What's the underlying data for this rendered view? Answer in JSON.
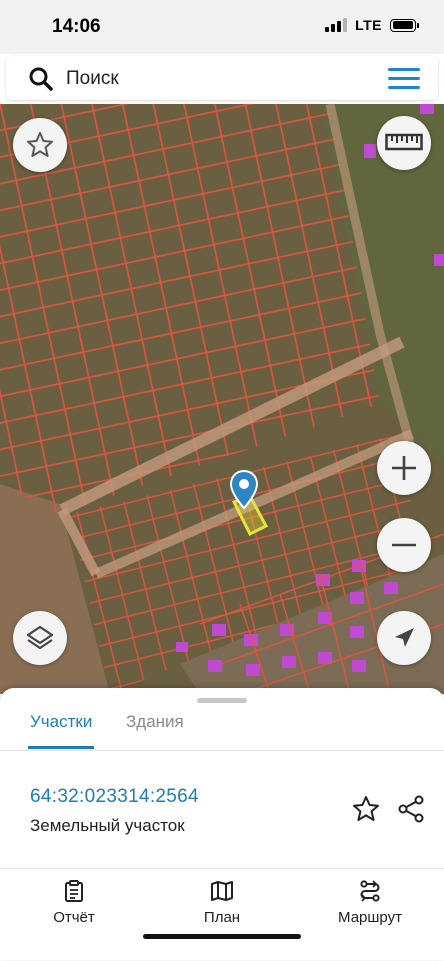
{
  "status_bar": {
    "time": "14:06",
    "network": "LTE"
  },
  "search": {
    "placeholder": "Поиск"
  },
  "map": {
    "selected_parcel_color": "#e8e23a",
    "boundary_color": "#e0553f",
    "pin_color": "#2d86c4",
    "buttons": {
      "favorite": "star-icon",
      "ruler": "ruler-icon",
      "zoom_in": "+",
      "zoom_out": "−",
      "layers": "layers-icon",
      "locate": "navigation-arrow-icon"
    }
  },
  "sheet": {
    "tabs": [
      {
        "label": "Участки",
        "active": true
      },
      {
        "label": "Здания",
        "active": false
      }
    ],
    "parcel": {
      "cadastral_number": "64:32:023314:2564",
      "type": "Земельный участок"
    }
  },
  "bottom_nav": {
    "items": [
      {
        "label": "Отчёт",
        "icon": "report-icon"
      },
      {
        "label": "План",
        "icon": "map-icon"
      },
      {
        "label": "Маршрут",
        "icon": "route-icon"
      }
    ]
  }
}
